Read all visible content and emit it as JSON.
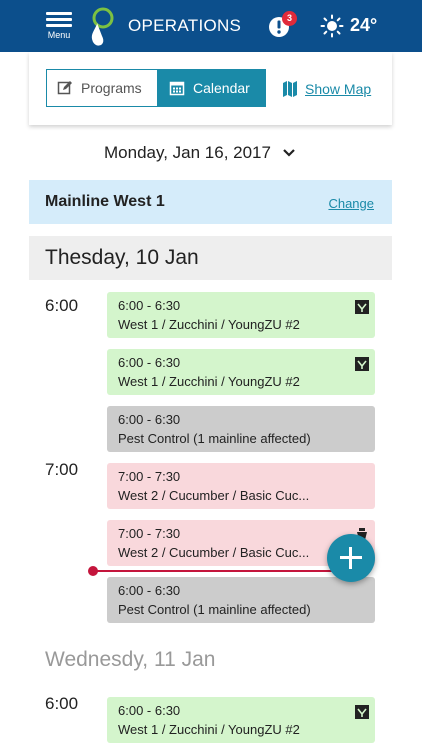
{
  "header": {
    "menu_label": "Menu",
    "title": "OPERATIONS",
    "alert_count": "3",
    "weather_icon": "sun-icon",
    "temperature": "24°",
    "colors": {
      "bar": "#0c4f8c",
      "badge": "#e02a3a"
    }
  },
  "tabs": {
    "programs_label": "Programs",
    "calendar_label": "Calendar",
    "show_map_label": "Show Map",
    "active": "Calendar"
  },
  "date_selector": {
    "value": "Monday, Jan 16, 2017"
  },
  "mainline": {
    "name": "Mainline West 1",
    "change_label": "Change"
  },
  "days": [
    {
      "title": "Thesday, 10 Jan",
      "time_labels": [
        "6:00",
        "7:00"
      ],
      "events": [
        {
          "time": "6:00 - 6:30",
          "label": "West 1 /  Zucchini / YoungZU #2",
          "color": "green",
          "icon": "program-icon"
        },
        {
          "time": "6:00 - 6:30",
          "label": "West 1 /  Zucchini / YoungZU #2",
          "color": "green",
          "icon": "program-icon"
        },
        {
          "time": "6:00 - 6:30",
          "label": "Pest Control (1 mainline affected)",
          "color": "gray"
        },
        {
          "time": "7:00 - 7:30",
          "label": "West 2 /  Cucumber / Basic Cuc...",
          "color": "pink"
        },
        {
          "time": "7:00 - 7:30",
          "label": "West 2 /  Cucumber / Basic Cuc...",
          "color": "pink",
          "icon": "fertilizer-icon"
        },
        {
          "time": "6:00 - 6:30",
          "label": "Pest Control (1 mainline affected)",
          "color": "gray"
        }
      ]
    },
    {
      "title": "Wednesdy, 11 Jan",
      "time_labels": [
        "6:00"
      ],
      "events": [
        {
          "time": "6:00 - 6:30",
          "label": "West 1 /  Zucchini / YoungZU #2",
          "color": "green",
          "icon": "program-icon"
        }
      ]
    }
  ],
  "colors": {
    "accent": "#1a8aa8",
    "event_green": "#d4f5cc",
    "event_pink": "#f9d8dc",
    "event_gray": "#cccccc",
    "now_line": "#c4153c",
    "mainline_bg": "#d5ecfa"
  }
}
